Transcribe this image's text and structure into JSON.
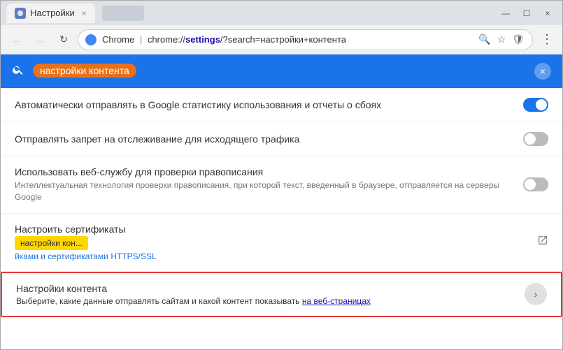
{
  "window": {
    "title": "Настройки",
    "tab_title": "Настройки",
    "close_btn": "×",
    "minimize_btn": "—",
    "maximize_btn": "☐"
  },
  "navbar": {
    "back_btn": "←",
    "forward_btn": "→",
    "refresh_btn": "↻",
    "site_label": "Chrome",
    "address_domain": "Chrome",
    "address_path": "/settings",
    "address_query": "/?search=настройки+контента",
    "full_address": "chrome://settings/?search=настройки+контента",
    "search_icon": "🔍",
    "star_icon": "☆",
    "shield_icon": "🛡",
    "menu_icon": "⋮"
  },
  "searchbar": {
    "placeholder": "настройки контента",
    "search_text": "настройки контента",
    "clear_icon": "×"
  },
  "settings": {
    "items": [
      {
        "title": "Автоматически отправлять в Google статистику использования и отчеты о сбоях",
        "desc": "",
        "toggle": "on",
        "type": "toggle"
      },
      {
        "title": "Отправлять запрет на отслеживание для исходящего трафика",
        "desc": "",
        "toggle": "off",
        "type": "toggle"
      },
      {
        "title": "Использовать веб-службу для проверки правописания",
        "desc": "Интеллектуальная технология проверки правописания, при которой текст, введенный в браузере, отправляется на серверы Google",
        "toggle": "off",
        "type": "toggle"
      },
      {
        "title": "Настроить сертификаты",
        "subtitle": "Управление сертификатами и сертификатами HTTPS/SSL",
        "type": "link",
        "tooltip": "настройки кон..."
      }
    ],
    "content_settings": {
      "title": "Настройки контента",
      "desc_part1": "Выберите, какие данные отправлять сайтам и какой контент показывать",
      "desc_link": "на веб-страницах",
      "chevron": "›"
    }
  }
}
